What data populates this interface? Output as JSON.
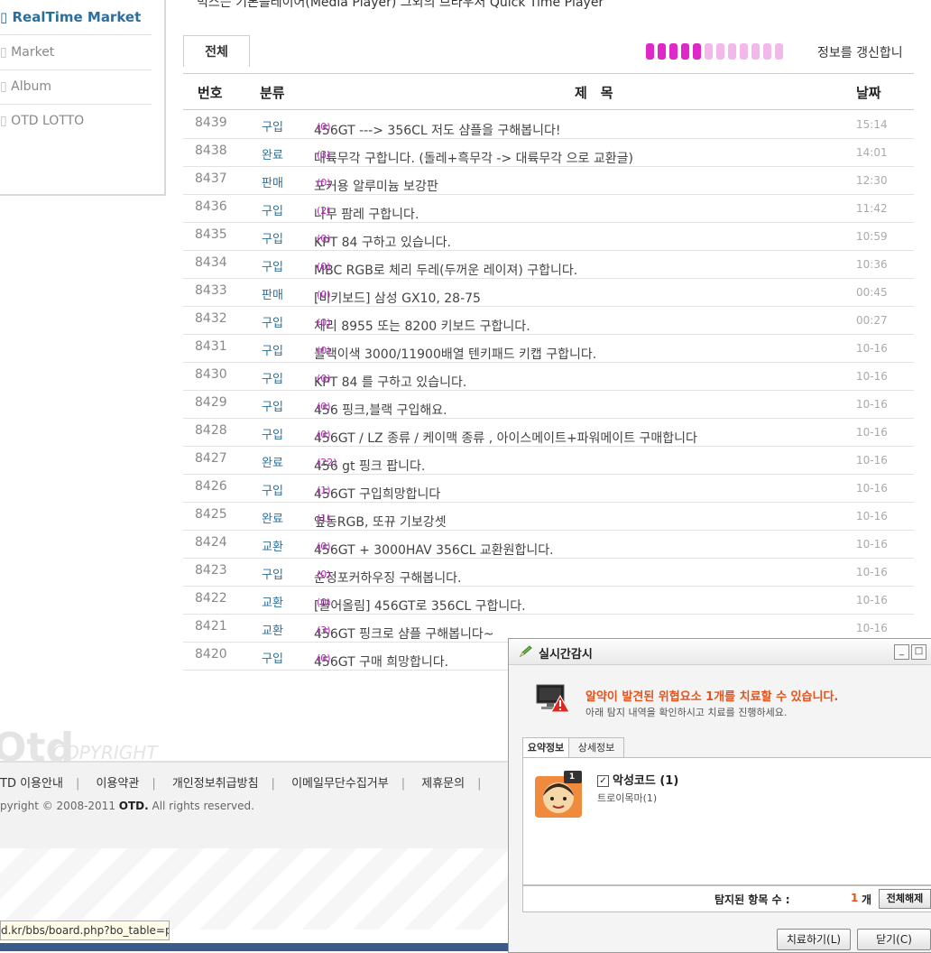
{
  "sidebar": {
    "items": [
      {
        "label": "RealTime Market",
        "active": true
      },
      {
        "label": "Market"
      },
      {
        "label": "Album"
      },
      {
        "label": "OTD LOTTO"
      }
    ]
  },
  "top_note": "믹스는 기본플레이어(Media Player) 그외의 브라우저 Quick Time Player",
  "tabs": {
    "all": "전체",
    "refresh_text": "정보를 갱신합니",
    "progress_filled": 5,
    "progress_total": 12,
    "progress_color_on": "#e028c8",
    "progress_color_off": "#f2b8ea"
  },
  "table": {
    "headers": {
      "num": "번호",
      "cat": "분류",
      "title": "제　목",
      "date": "날짜"
    },
    "rows": [
      {
        "num": "8439",
        "cat": "구입",
        "title": "456GT ---> 356CL 저도 샴플을 구해봅니다!",
        "count": "(0)",
        "date": "15:14"
      },
      {
        "num": "8438",
        "cat": "완료",
        "title": "대륙무각 구합니다. (돌레+흑무각 -> 대륙무각 으로 교환글)",
        "count": "(3)",
        "date": "14:01"
      },
      {
        "num": "8437",
        "cat": "판매",
        "title": "포커용 알루미늄 보강판",
        "count": "(0)",
        "date": "12:30"
      },
      {
        "num": "8436",
        "cat": "구입",
        "title": "나무 팜레 구합니다.",
        "count": "(2)",
        "date": "11:42"
      },
      {
        "num": "8435",
        "cat": "구입",
        "title": "KPT 84 구하고 있습니다.",
        "count": "(0)",
        "date": "10:59"
      },
      {
        "num": "8434",
        "cat": "구입",
        "title": "MBC RGB로 체리 두레(두꺼운 레이져) 구합니다.",
        "count": "(0)",
        "date": "10:36"
      },
      {
        "num": "8433",
        "cat": "판매",
        "title": "[비키보드] 삼성 GX10, 28-75",
        "count": "(0)",
        "date": "00:45"
      },
      {
        "num": "8432",
        "cat": "구입",
        "title": "체리 8955 또는 8200 키보드 구합니다.",
        "count": "(0)",
        "date": "00:27"
      },
      {
        "num": "8431",
        "cat": "구입",
        "title": "블랙이색 3000/11900배열 텐키패드 키캡 구합니다.",
        "count": "(0)",
        "date": "10-16"
      },
      {
        "num": "8430",
        "cat": "구입",
        "title": "KPT 84 를 구하고 있습니다.",
        "count": "(0)",
        "date": "10-16"
      },
      {
        "num": "8429",
        "cat": "구입",
        "title": "456 핑크,블랙 구입해요.",
        "count": "(0)",
        "date": "10-16"
      },
      {
        "num": "8428",
        "cat": "구입",
        "title": "456GT / LZ 종류 / 케이맥 종류 , 아이스메이트+파워메이트 구매합니다",
        "count": "(0)",
        "date": "10-16"
      },
      {
        "num": "8427",
        "cat": "완료",
        "title": "456 gt 핑크 팝니다.",
        "count": "(22)",
        "date": "10-16"
      },
      {
        "num": "8426",
        "cat": "구입",
        "title": "456GT 구입희망합니다",
        "count": "(1)",
        "date": "10-16"
      },
      {
        "num": "8425",
        "cat": "완료",
        "title": "옆동RGB, 또뀨 기보강셋",
        "count": "(1)",
        "date": "10-16"
      },
      {
        "num": "8424",
        "cat": "교환",
        "title": "456GT + 3000HAV 356CL 교환원합니다.",
        "count": "(0)",
        "date": "10-16"
      },
      {
        "num": "8423",
        "cat": "구입",
        "title": "순정포커하우징 구해봅니다.",
        "count": "(0)",
        "date": "10-16"
      },
      {
        "num": "8422",
        "cat": "교환",
        "title": "[끌어올림] 456GT로 356CL 구합니다.",
        "count": "(0)",
        "date": "10-16"
      },
      {
        "num": "8421",
        "cat": "교환",
        "title": "456GT 핑크로 샴플 구해봅니다~",
        "count": "(3)",
        "date": "10-16"
      },
      {
        "num": "8420",
        "cat": "구입",
        "title": "456GT 구매 희망합니다.",
        "count": "(0)",
        "date": ""
      }
    ]
  },
  "footer": {
    "logo_otd": "Otd",
    "logo_copyright": "COPYRIGHT",
    "links": [
      "TD 이용안내",
      "이용약관",
      "개인정보취급방침",
      "이메일무단수집거부",
      "제휴문의"
    ],
    "copyright_prefix": "pyright © 2008-2011 ",
    "copyright_brand": "OTD.",
    "copyright_suffix": " All rights reserved.",
    "status_url": "d.kr/bbs/board.php?bo_table=pds"
  },
  "popup": {
    "title": "실시간감시",
    "warning": "알약이 발견된 위협요소 1개를 치료할 수 있습니다.",
    "sub": "아래 탐지 내역을 확인하시고 치료를 진행하세요.",
    "tabs": [
      "요약정보",
      "상세정보"
    ],
    "badge": "1",
    "item_label": "악성코드 (1)",
    "item_detail": "트로이목마(1)",
    "count_label": "탐지된 항목 수 :",
    "count_value": "1",
    "count_unit": "개",
    "clear_all": "전체해제",
    "treat_button": "치료하기(L)",
    "close_button": "닫기(C)",
    "warn_color": "#e0551d"
  }
}
